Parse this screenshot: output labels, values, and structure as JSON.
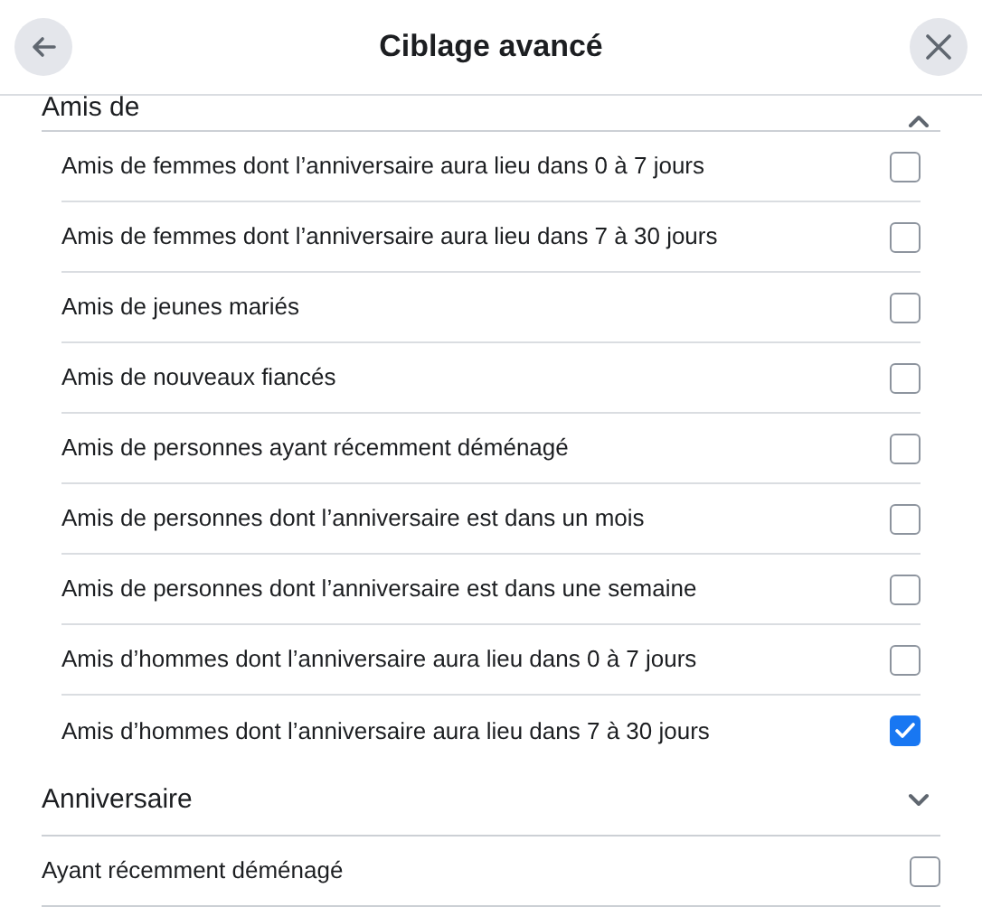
{
  "header": {
    "title": "Ciblage avancé"
  },
  "sections": [
    {
      "label": "Amis de",
      "expanded": true,
      "items": [
        {
          "label": "Amis de femmes dont l’anniversaire aura lieu dans 0 à 7 jours",
          "checked": false
        },
        {
          "label": "Amis de femmes dont l’anniversaire aura lieu dans 7 à 30 jours",
          "checked": false
        },
        {
          "label": "Amis de jeunes mariés",
          "checked": false
        },
        {
          "label": "Amis de nouveaux fiancés",
          "checked": false
        },
        {
          "label": "Amis de personnes ayant récemment déménagé",
          "checked": false
        },
        {
          "label": "Amis de personnes dont l’anniversaire est dans un mois",
          "checked": false
        },
        {
          "label": "Amis de personnes dont l’anniversaire est dans une semaine",
          "checked": false
        },
        {
          "label": "Amis d’hommes dont l’anniversaire aura lieu dans 0 à 7 jours",
          "checked": false
        },
        {
          "label": "Amis d’hommes dont l’anniversaire aura lieu dans 7 à 30 jours",
          "checked": true
        }
      ]
    },
    {
      "label": "Anniversaire",
      "expanded": false
    }
  ],
  "options": [
    {
      "label": "Ayant récemment déménagé",
      "checked": false
    }
  ]
}
